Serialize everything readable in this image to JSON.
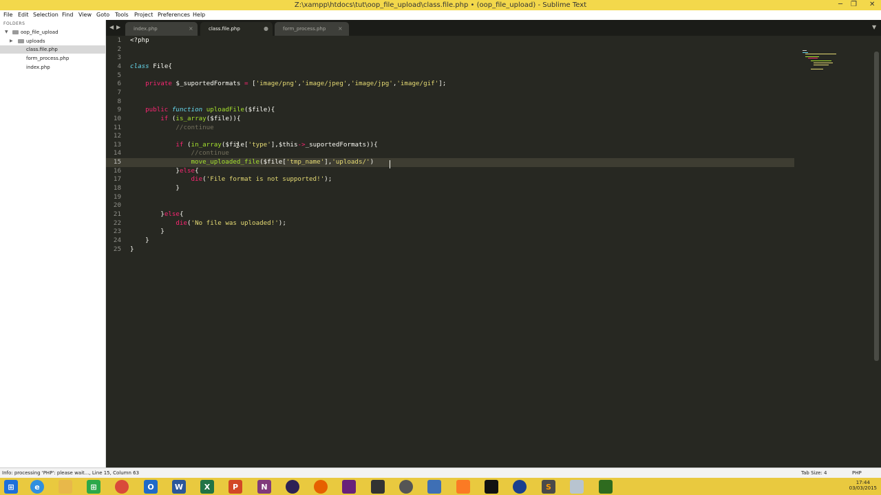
{
  "window": {
    "title": "Z:\\xampp\\htdocs\\tut\\oop_file_upload\\class.file.php • (oop_file_upload) - Sublime Text",
    "minimize": "─",
    "maximize": "❐",
    "close": "✕"
  },
  "menu": [
    "File",
    "Edit",
    "Selection",
    "Find",
    "View",
    "Goto",
    "Tools",
    "Project",
    "Preferences",
    "Help"
  ],
  "sidebar": {
    "header": "FOLDERS",
    "root": "oop_file_upload",
    "items": [
      {
        "label": "uploads",
        "type": "folder"
      },
      {
        "label": "class.file.php",
        "type": "file",
        "selected": true
      },
      {
        "label": "form_process.php",
        "type": "file"
      },
      {
        "label": "index.php",
        "type": "file"
      }
    ]
  },
  "tabs": [
    {
      "label": "index.php",
      "active": false,
      "close": "×"
    },
    {
      "label": "class.file.php",
      "active": true,
      "close": "●"
    },
    {
      "label": "form_process.php",
      "active": false,
      "close": "×"
    }
  ],
  "tabnav": {
    "left": "◀",
    "right": "▶",
    "dropdown": "▼"
  },
  "code": {
    "current_line": 15,
    "lines": [
      "1",
      "2",
      "3",
      "4",
      "5",
      "6",
      "7",
      "8",
      "9",
      "10",
      "11",
      "12",
      "13",
      "14",
      "15",
      "16",
      "17",
      "18",
      "19",
      "20",
      "21",
      "22",
      "23",
      "24",
      "25"
    ],
    "t": {
      "php_open": "<?php",
      "kw_class": "class",
      "class_name": "File{",
      "kw_private": "private",
      "prop_name": " $_suportedFormats ",
      "op_eq": "=",
      "fmt_open": " [",
      "s_png": "'image/png'",
      "s_jpeg": "'image/jpeg'",
      "s_jpg": "'image/jpg'",
      "s_gif": "'image/gif'",
      "comma": ",",
      "fmt_close": "];",
      "kw_public": "public",
      "kw_function": "function",
      "fn_upload": "uploadFile",
      "fn_params": "($file){",
      "kw_if": "if",
      "paren_open": " (",
      "fn_is_array": "is_array",
      "is_array_arg": "($file)){",
      "cmt_continue": "//continue",
      "fn_in_array": "in_array",
      "in_array_a": "($file[",
      "s_type": "'type'",
      "in_array_b": "],$this",
      "op_arrow": "->",
      "in_array_c": "_suportedFormats)){",
      "fn_move": "move_uploaded_file",
      "move_a": "($file[",
      "s_tmp": "'tmp_name'",
      "move_b": "],",
      "s_uploads": "'uploads/",
      "s_quote": "'",
      "move_close": ")",
      "close_else_open": "}",
      "kw_else": "else",
      "brace_open": "{",
      "fn_die": "die",
      "paren": "(",
      "s_notsupported": "'File format is not supported!'",
      "paren_close": ");",
      "brace_close": "}",
      "s_nofile": "'No file was uploaded!'"
    }
  },
  "ibeam": "I",
  "status": {
    "left": "Info: processing 'PHP': please wait..., Line 15, Column 63",
    "tab_size": "Tab Size: 4",
    "syntax": "PHP"
  },
  "taskbar": {
    "icons": [
      "windows-start",
      "internet-explorer",
      "file-explorer",
      "store",
      "chrome",
      "outlook",
      "word",
      "excel",
      "powerpoint",
      "onenote",
      "eclipse",
      "firefox",
      "visual-studio",
      "unity",
      "blender",
      "virtualbox",
      "xampp",
      "command-prompt",
      "app-slash",
      "sublime-text",
      "app-tools",
      "nvidia"
    ],
    "time": "17:44",
    "date": "03/03/2015"
  },
  "colors": {
    "titlebar": "#f3d84b",
    "editor_bg": "#272822",
    "keyword": "#f92672",
    "string": "#e6db74",
    "function": "#a6e22e",
    "comment": "#75715e",
    "storage": "#66d9ef",
    "taskbar": "#e9c93f"
  }
}
